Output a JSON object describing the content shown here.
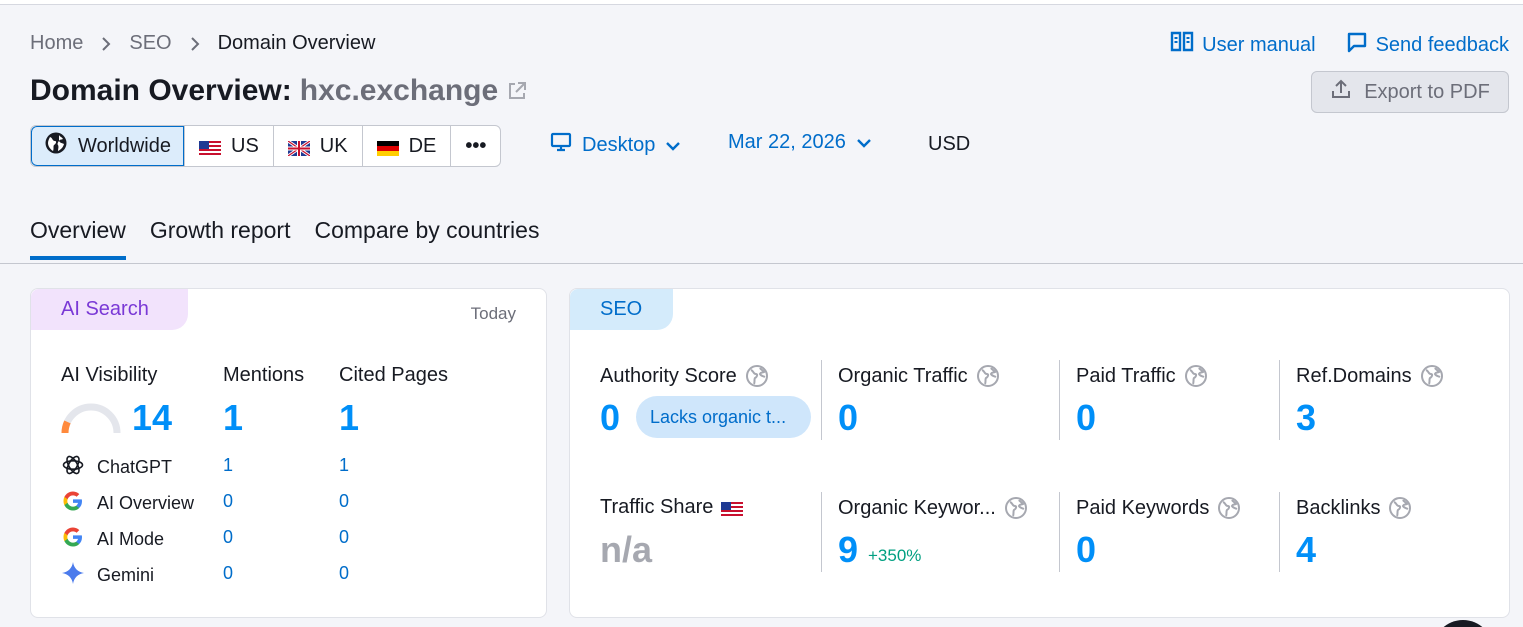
{
  "breadcrumb": {
    "home": "Home",
    "section": "SEO",
    "current": "Domain Overview"
  },
  "top_links": {
    "manual": "User manual",
    "feedback": "Send feedback"
  },
  "title": {
    "prefix": "Domain Overview:",
    "domain": "hxc.exchange"
  },
  "export_label": "Export to PDF",
  "databases": [
    {
      "label": "Worldwide",
      "icon": "globe-icon"
    },
    {
      "label": "US",
      "icon": "us-flag-icon"
    },
    {
      "label": "UK",
      "icon": "uk-flag-icon"
    },
    {
      "label": "DE",
      "icon": "de-flag-icon"
    },
    {
      "label": "•••",
      "icon": "more-icon"
    }
  ],
  "device": "Desktop",
  "date": "Mar 22, 2026",
  "currency": "USD",
  "tabs": [
    "Overview",
    "Growth report",
    "Compare by countries"
  ],
  "ai_card": {
    "chip": "AI Search",
    "period": "Today",
    "visibility_label": "AI Visibility",
    "visibility_value": "14",
    "visibility_level": 0.14,
    "mentions_label": "Mentions",
    "mentions_value": "1",
    "cited_label": "Cited Pages",
    "cited_value": "1",
    "rows": [
      {
        "name": "ChatGPT",
        "mentions": "1",
        "cited": "1"
      },
      {
        "name": "AI Overview",
        "mentions": "0",
        "cited": "0"
      },
      {
        "name": "AI Mode",
        "mentions": "0",
        "cited": "0"
      },
      {
        "name": "Gemini",
        "mentions": "0",
        "cited": "0"
      }
    ]
  },
  "seo_card": {
    "chip": "SEO",
    "authority_label": "Authority Score",
    "authority_value": "0",
    "authority_badge": "Lacks organic t...",
    "organic_traffic_label": "Organic Traffic",
    "organic_traffic_value": "0",
    "paid_traffic_label": "Paid Traffic",
    "paid_traffic_value": "0",
    "ref_domains_label": "Ref.Domains",
    "ref_domains_value": "3",
    "traffic_share_label": "Traffic Share",
    "traffic_share_value": "n/a",
    "organic_keywords_label": "Organic Keywor...",
    "organic_keywords_value": "9",
    "organic_keywords_delta": "+350%",
    "paid_keywords_label": "Paid Keywords",
    "paid_keywords_value": "0",
    "backlinks_label": "Backlinks",
    "backlinks_value": "4"
  },
  "colors": {
    "accent": "#006dca",
    "value_blue": "#008ff8",
    "positive": "#009f81",
    "ai_chip": "#f2e3fc"
  }
}
